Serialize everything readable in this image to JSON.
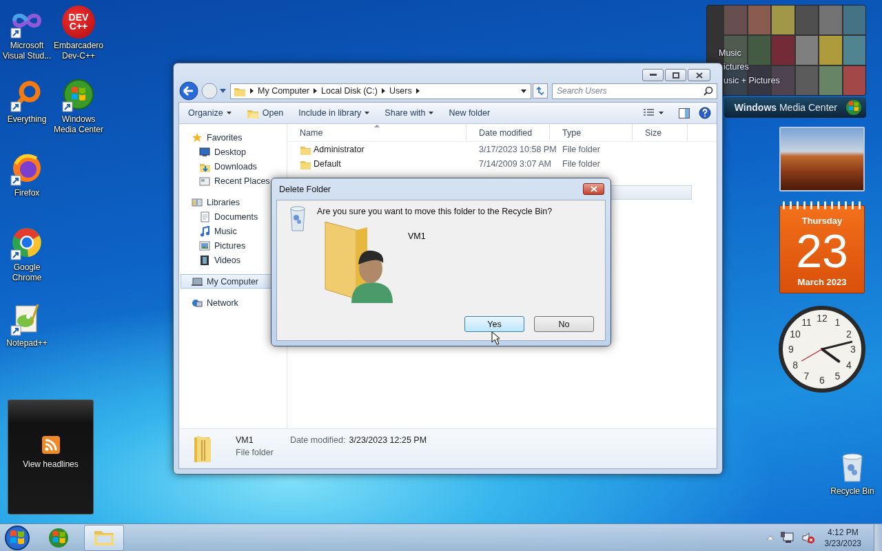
{
  "desktop_icons": [
    {
      "label": "Microsoft Visual Stud..."
    },
    {
      "label": "Embarcadero Dev-C++",
      "icon_text": "DEV C++"
    },
    {
      "label": "Everything"
    },
    {
      "label": "Windows Media Center"
    },
    {
      "label": "Firefox"
    },
    {
      "label": "Google Chrome"
    },
    {
      "label": "Notepad++"
    },
    {
      "label": "Recycle Bin"
    }
  ],
  "explorer": {
    "breadcrumbs": [
      "My Computer",
      "Local Disk (C:)",
      "Users"
    ],
    "search": {
      "placeholder": "Search Users"
    },
    "toolbar": [
      {
        "label": "Organize",
        "kind": "menu"
      },
      {
        "label": "Open",
        "kind": "icon"
      },
      {
        "label": "Include in library",
        "kind": "menu"
      },
      {
        "label": "Share with",
        "kind": "menu"
      },
      {
        "label": "New folder",
        "kind": "plain"
      }
    ],
    "navigation": [
      {
        "label": "Favorites",
        "selected": false,
        "children": [
          {
            "label": "Desktop",
            "selected": false
          },
          {
            "label": "Downloads",
            "selected": false
          },
          {
            "label": "Recent Places",
            "selected": false
          }
        ]
      },
      {
        "label": "Libraries",
        "selected": false,
        "children": [
          {
            "label": "Documents",
            "selected": false
          },
          {
            "label": "Music",
            "selected": false
          },
          {
            "label": "Pictures",
            "selected": false
          },
          {
            "label": "Videos",
            "selected": false
          }
        ]
      },
      {
        "label": "My Computer",
        "selected": true
      },
      {
        "label": "Network",
        "selected": false
      }
    ],
    "columns": [
      {
        "label": "Name",
        "sorted": true
      },
      {
        "label": "Date modified",
        "sorted": false
      },
      {
        "label": "Type",
        "sorted": false
      },
      {
        "label": "Size",
        "sorted": false
      }
    ],
    "rows": [
      {
        "cells": [
          "Administrator",
          "3/17/2023 10:58 PM",
          "File folder"
        ],
        "selected": false
      },
      {
        "cells": [
          "Default",
          "7/14/2009 3:07 AM",
          "File folder"
        ],
        "selected": false
      }
    ],
    "covered_rows": [
      {
        "selected": false
      },
      {
        "selected": true
      }
    ],
    "details": {
      "name": "VM1",
      "type": "File folder",
      "date_label": "Date modified:",
      "date": "3/23/2023 12:25 PM"
    }
  },
  "dialog": {
    "title": "Delete Folder",
    "message": "Are you sure you want to move this folder to the Recycle Bin?",
    "item_name": "VM1",
    "buttons": [
      {
        "label": "Yes",
        "default": true
      },
      {
        "label": "No",
        "default": false
      }
    ]
  },
  "media_center": {
    "menu": [
      "Music",
      "ictures",
      "usic + Pictures"
    ],
    "title": "**Windows** Media Center"
  },
  "calendar": {
    "weekday": "Thursday",
    "day": "23",
    "month_year": "March 2023"
  },
  "clock": {
    "numerals": [
      "12",
      "1",
      "2",
      "3",
      "4",
      "5",
      "6",
      "7",
      "8",
      "9",
      "10",
      "11"
    ]
  },
  "feed": {
    "label": "View headlines"
  },
  "taskbar": {
    "buttons": [
      {
        "kind": "media_center",
        "active": false
      },
      {
        "kind": "explorer",
        "active": true
      }
    ],
    "volume_muted": true,
    "time": "4:12 PM",
    "date": "3/23/2023"
  }
}
